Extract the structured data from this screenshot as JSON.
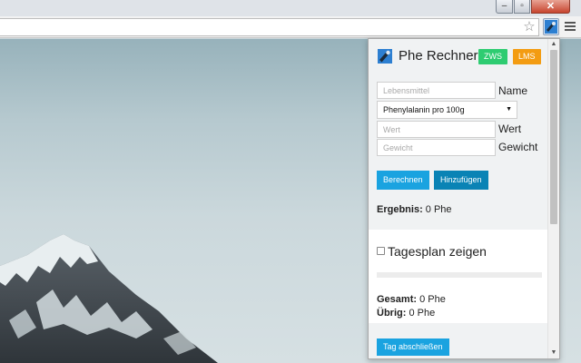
{
  "browser": {
    "window_controls": {
      "minimize": "–",
      "maximize": "▫",
      "close": "✕"
    },
    "toolbar": {
      "star_icon": "star-icon",
      "extension_icon": "phe-rechner-icon",
      "menu_icon": "hamburger-menu-icon"
    }
  },
  "popup": {
    "title": "Phe Rechner",
    "badges": {
      "zws": "ZWS",
      "lms": "LMS"
    },
    "form": {
      "lebensmittel_placeholder": "Lebensmittel",
      "lebensmittel_value": "",
      "name_label": "Name",
      "select_value": "Phenylalanin pro 100g",
      "wert_placeholder": "Wert",
      "wert_label": "Wert",
      "gewicht_placeholder": "Gewicht",
      "gewicht_label": "Gewicht"
    },
    "buttons": {
      "berechnen": "Berechnen",
      "hinzufuegen": "Hinzufügen",
      "tag_abschliessen": "Tag abschließen"
    },
    "result": {
      "label": "Ergebnis:",
      "value": "0 Phe"
    },
    "tagesplan": {
      "checkbox_label": "Tagesplan zeigen",
      "checked": false,
      "progress_fraction": 0,
      "gesamt_label": "Gesamt:",
      "gesamt_value": "0 Phe",
      "uebrig_label": "Übrig:",
      "uebrig_value": "0 Phe"
    },
    "colors": {
      "primary": "#1aa3e0",
      "secondary": "#0a83b5",
      "zws": "#2ecc71",
      "lms": "#f39c12"
    }
  }
}
